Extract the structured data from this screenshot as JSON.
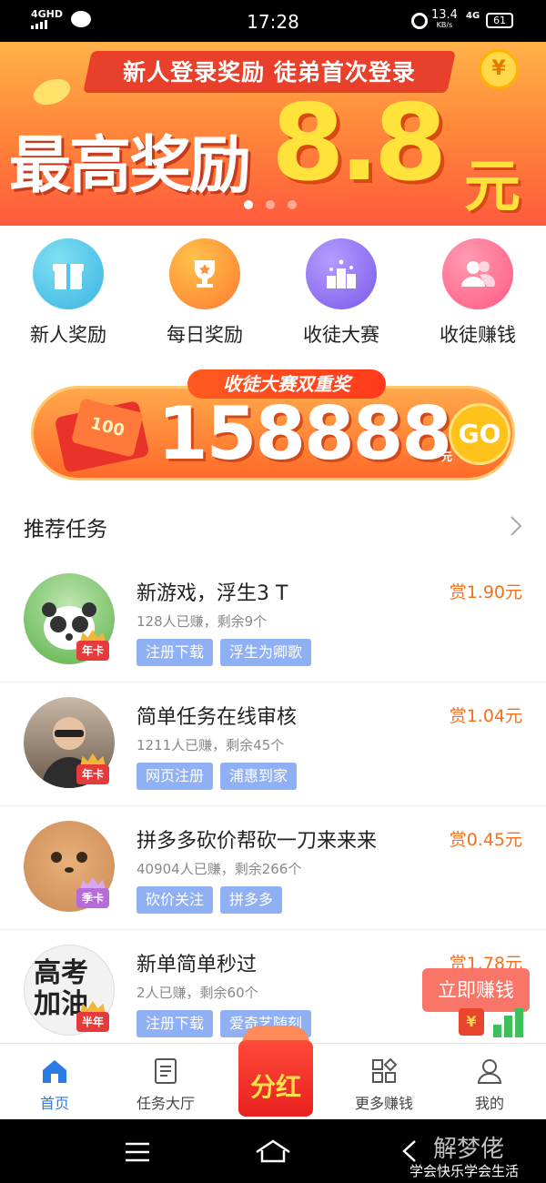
{
  "status_bar": {
    "network": "4GHD",
    "time": "17:28",
    "speed": "13.4",
    "speed_unit": "KB/s",
    "network2": "4G",
    "battery": "61"
  },
  "banner": {
    "subtitle": "新人登录奖励 徒弟首次登录",
    "headline": "最高奖励",
    "amount": "8.8",
    "unit": "元",
    "coin_symbol": "¥"
  },
  "quick_entries": [
    {
      "label": "新人奖励",
      "icon": "gift-icon",
      "color": "#4ec4e8"
    },
    {
      "label": "每日奖励",
      "icon": "trophy-icon",
      "color": "#ff8f3a"
    },
    {
      "label": "收徒大赛",
      "icon": "podium-icon",
      "color": "#8a6cf0"
    },
    {
      "label": "收徒赚钱",
      "icon": "users-icon",
      "color": "#ff6a8a"
    }
  ],
  "promo": {
    "tag": "收徒大赛双重奖",
    "amount": "158888",
    "unit": "元",
    "go": "GO",
    "envelope_text": "100"
  },
  "section": {
    "title": "推荐任务"
  },
  "tasks": [
    {
      "title": "新游戏，浮生3 T",
      "reward": "赏1.90元",
      "meta": "128人已赚，剩余9个",
      "tags": [
        "注册下载",
        "浮生为卿歌"
      ],
      "badge": "年卡"
    },
    {
      "title": "简单任务在线审核",
      "reward": "赏1.04元",
      "meta": "1211人已赚，剩余45个",
      "tags": [
        "网页注册",
        "浦惠到家"
      ],
      "badge": "年卡"
    },
    {
      "title": "拼多多砍价帮砍一刀来来来",
      "reward": "赏0.45元",
      "meta": "40904人已赚，剩余266个",
      "tags": [
        "砍价关注",
        "拼多多"
      ],
      "badge": "季卡"
    },
    {
      "title": "新单简单秒过",
      "reward": "赏1.78元",
      "meta": "2人已赚，剩余60个",
      "tags": [
        "注册下载",
        "爱奇艺随刻"
      ],
      "badge": "半年",
      "avatar_text": "高考加油"
    }
  ],
  "float_button": {
    "label": "立即赚钱",
    "coin_symbol": "¥"
  },
  "tabbar": {
    "home": "首页",
    "tasks": "任务大厅",
    "center": "分红",
    "more": "更多赚钱",
    "mine": "我的",
    "active_color": "#2a7be4"
  },
  "watermark": {
    "line1": "解梦佬",
    "line2": "学会快乐学会生活"
  }
}
